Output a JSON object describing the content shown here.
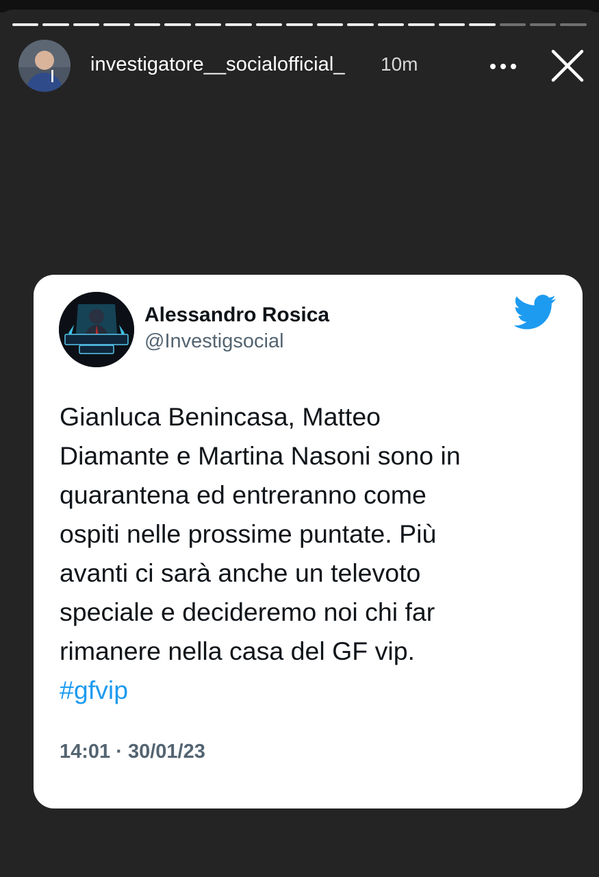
{
  "story": {
    "username": "investigatore__socialofficial_",
    "time": "10m",
    "progress": {
      "segments_total": 19,
      "segments_viewed": 16
    }
  },
  "icons": {
    "more": "more-horizontal-icon",
    "close": "close-icon",
    "twitter": "twitter-bird-icon"
  },
  "tweet": {
    "author_name": "Alessandro Rosica",
    "author_handle": "@Investigsocial",
    "avatar_text": "INVESTIGATORE SOCIAL",
    "text": "Gianluca Benincasa, Matteo\nDiamante e Martina Nasoni sono in\nquarantena ed entreranno come\nospiti nelle prossime puntate. Più\navanti ci sarà anche un televoto\nspeciale e decideremo noi chi far\nrimanere nella casa del GF vip.",
    "hashtag": "#gfvip",
    "timestamp": "14:01 · 30/01/23"
  },
  "colors": {
    "story_background": "#242424",
    "card_background": "#ffffff",
    "twitter_blue": "#1d9bf0",
    "secondary_text": "#536471"
  }
}
